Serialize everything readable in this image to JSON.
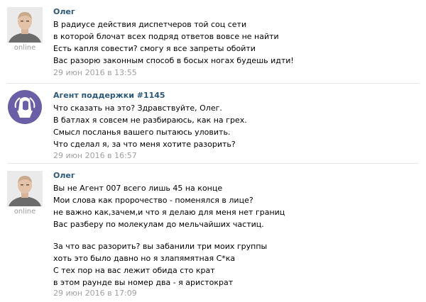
{
  "messages": [
    {
      "author": "Олег",
      "status": "online",
      "avatar_icon": "user-photo-icon",
      "lines": [
        "В радиусе действия диспетчеров той соц сети",
        "в которой блочат всех подряд ответов вовсе не найти",
        "Есть капля совести? смогу я все запреты обойти",
        "Вас разорю законным способ в босых ногах будешь идти!"
      ],
      "date": "29 июн 2016 в 13:55"
    },
    {
      "author": "Агент поддержки #1145",
      "status": "",
      "avatar_icon": "support-agent-icon",
      "lines": [
        "Что сказать на это? Здравствуйте, Олег.",
        "В батлах я совсем не разбираюсь, как на грех.",
        "Смысл посланья вашего пытаюсь уловить.",
        "Что сделал я, за что меня хотите разорить?"
      ],
      "date": "29 июн 2016 в 16:57"
    },
    {
      "author": "Олег",
      "status": "online",
      "avatar_icon": "user-photo-icon",
      "lines": [
        "Вы не Агент 007 всего лишь 45 на конце",
        "Мои слова как пророчество - поменялся в лице?",
        "не важно как,зачем,и что я делаю для меня нет границ",
        "Вас разберу по молекулам до мельчайших частиц.",
        "",
        "За что вас разорить? вы забанили три моих группы",
        "хоть это было давно но я злапямятная С*ка",
        "С тех пор на вас лежит обида сто крат",
        "в этом раунде вы номер два - я аристократ"
      ],
      "date": "29 июн 2016 в 17:09"
    }
  ]
}
